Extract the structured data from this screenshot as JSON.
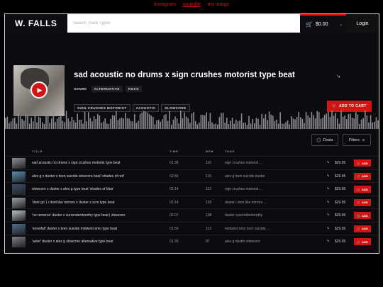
{
  "top_links": [
    "instagram",
    "youtube",
    "my songs"
  ],
  "header": {
    "logo": "W. FALLS",
    "search_placeholder": "Search Track Types",
    "cart_total": "$0.00",
    "login": "Login"
  },
  "featured": {
    "title": "sad acoustic no drums x sign crushes motorist type beat",
    "genre_label": "GENRE",
    "genres": [
      "ALTERNATIVE",
      "ROCK"
    ],
    "tags": [
      "SIGN CRUSHES MOTORIST",
      "ACOUSTIC",
      "SLOWCORE"
    ],
    "add_to_cart": "ADD TO CART"
  },
  "toolbar": {
    "deals": "Deals",
    "filters": "Filters"
  },
  "table": {
    "headers": {
      "title": "TITLE",
      "time": "TIME",
      "bpm": "BPM",
      "tags": "TAGS"
    },
    "rows": [
      {
        "title": "sad acoustic no drums x sign crushes motorist type beat",
        "time": "01:36",
        "bpm": "110",
        "tags": "sign crushes motorist ...",
        "price": "$29.95",
        "add": "ADD"
      },
      {
        "title": "alex g x duster x teen suicide slowcore beat 'shades of red'",
        "time": "02:56",
        "bpm": "115",
        "tags": "alex g  teen suicide  duster",
        "price": "$29.95",
        "add": "ADD"
      },
      {
        "title": "slowcore x duster x alex g type beat 'shades of blue'",
        "time": "02:14",
        "bpm": "113",
        "tags": "sign crushes motorist ...",
        "price": "$29.95",
        "add": "ADD"
      },
      {
        "title": "'dont go' | i dont like mirrors x duster x scm type beat",
        "time": "02:14",
        "bpm": "102",
        "tags": "duster  i dont like mirrors ...",
        "price": "$29.95",
        "add": "ADD"
      },
      {
        "title": "'no remorse' duster x surrenderdorothy type beat | slowcore",
        "time": "02:07",
        "bpm": "108",
        "tags": "duster  surrenderdorothy",
        "price": "$29.95",
        "add": "ADD"
      },
      {
        "title": "'snowfall' duster x teen suicide midwest emo type beat",
        "time": "01:59",
        "bpm": "113",
        "tags": "midwest emo  teen suicide ...",
        "price": "$29.95",
        "add": "ADD"
      },
      {
        "title": "'aster' duster x alex g slowcore alternative type beat",
        "time": "01:39",
        "bpm": "87",
        "tags": "alex g  duster  slowcore",
        "price": "$29.95",
        "add": "ADD"
      }
    ]
  },
  "colors": {
    "accent": "#d41414",
    "background": "#0c0c10"
  }
}
